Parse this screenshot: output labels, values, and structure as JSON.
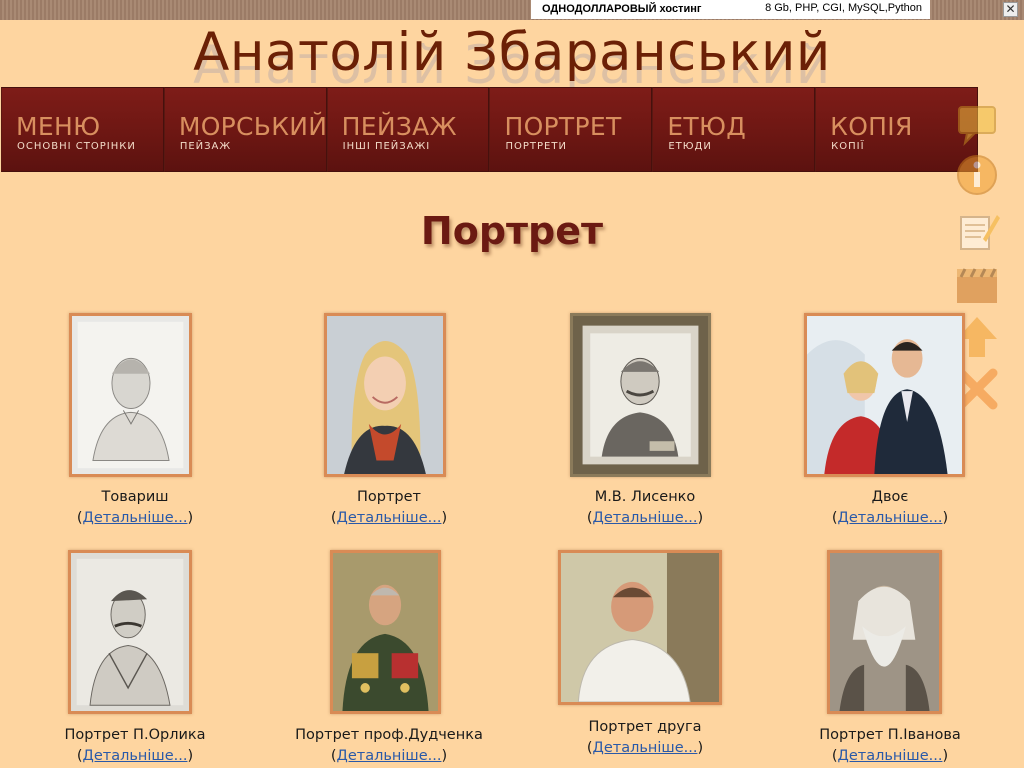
{
  "adbar": {
    "left_text": "ОДНОДОЛЛАРОВЫЙ хостинг",
    "right_text": "8 Gb,  PHP, CGI, MySQL,Python",
    "close_glyph": "✕"
  },
  "site": {
    "title": "Анатолій Збаранський"
  },
  "nav": [
    {
      "label": "МЕНЮ",
      "sub": "ОСНОВНІ СТОРІНКИ"
    },
    {
      "label": "МОРСЬКИЙ",
      "sub": "ПЕЙЗАЖ"
    },
    {
      "label": "ПЕЙЗАЖ",
      "sub": "ІНШІ ПЕЙЗАЖІ"
    },
    {
      "label": "ПОРТРЕТ",
      "sub": "ПОРТРЕТИ"
    },
    {
      "label": "ЕТЮД",
      "sub": "ЕТЮДИ"
    },
    {
      "label": "КОПІЯ",
      "sub": "КОПІЇ"
    }
  ],
  "side_icons": [
    "comment-icon",
    "info-icon",
    "edit-note-icon",
    "video-icon",
    "arrow-up-icon",
    "close-icon"
  ],
  "page": {
    "heading": "Портрет"
  },
  "gallery": {
    "more_label": "Детальніше...",
    "open_paren": "(",
    "close_paren": ")",
    "items": [
      {
        "caption": "Товариш"
      },
      {
        "caption": "Портрет"
      },
      {
        "caption": "М.В. Лисенко"
      },
      {
        "caption": "Двоє"
      },
      {
        "caption": "Портрет П.Орлика"
      },
      {
        "caption": "Портрет проф.Дудченка"
      },
      {
        "caption": "Портрет друга"
      },
      {
        "caption": "Портрет П.Іванова"
      }
    ]
  },
  "colors": {
    "background": "#fed5a0",
    "nav_bg": "#6d1713",
    "title": "#6b2006",
    "frame_border": "#d98b55",
    "link": "#2a59a8"
  }
}
